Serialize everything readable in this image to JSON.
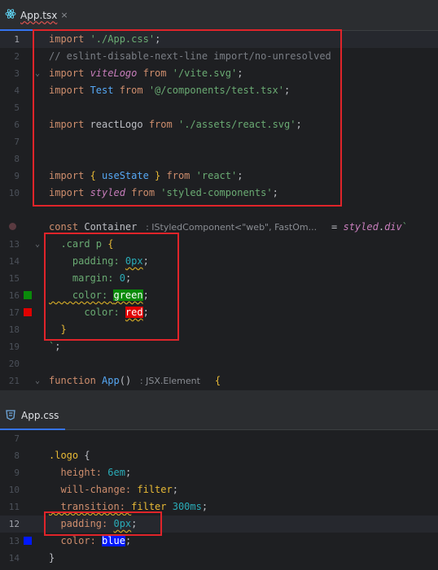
{
  "top_tab": {
    "icon": "react-icon",
    "label": "App.tsx",
    "close": "×"
  },
  "bottom_tab": {
    "icon": "css-icon",
    "label": "App.css"
  },
  "top_lines": [
    {
      "n": "1",
      "parts": [
        [
          "k",
          "import "
        ],
        [
          "s",
          "'./App.css'"
        ],
        [
          "p",
          ";"
        ]
      ]
    },
    {
      "n": "2",
      "parts": [
        [
          "c",
          "// eslint-disable-next-line import/no-unresolved"
        ]
      ]
    },
    {
      "n": "3",
      "parts": [
        [
          "k",
          "import "
        ],
        [
          "i",
          "viteLogo"
        ],
        [
          "k",
          " from "
        ],
        [
          "s",
          "'/vite.svg'"
        ],
        [
          "p",
          ";"
        ]
      ]
    },
    {
      "n": "4",
      "parts": [
        [
          "k",
          "import "
        ],
        [
          "t",
          "Test"
        ],
        [
          "k",
          " from "
        ],
        [
          "s",
          "'@/components/test.tsx'"
        ],
        [
          "p",
          ";"
        ]
      ]
    },
    {
      "n": "5",
      "parts": []
    },
    {
      "n": "6",
      "parts": [
        [
          "k",
          "import "
        ],
        [
          "p",
          "reactLogo"
        ],
        [
          "k",
          " from "
        ],
        [
          "s",
          "'./assets/react.svg'"
        ],
        [
          "p",
          ";"
        ]
      ]
    },
    {
      "n": "7",
      "parts": []
    },
    {
      "n": "8",
      "parts": []
    },
    {
      "n": "9",
      "parts": [
        [
          "k",
          "import "
        ],
        [
          "y",
          "{ "
        ],
        [
          "t",
          "useState"
        ],
        [
          "y",
          " }"
        ],
        [
          "k",
          " from "
        ],
        [
          "s",
          "'react'"
        ],
        [
          "p",
          ";"
        ]
      ]
    },
    {
      "n": "10",
      "parts": [
        [
          "k",
          "import "
        ],
        [
          "i",
          "styled"
        ],
        [
          "k",
          " from "
        ],
        [
          "s",
          "'styled-components'"
        ],
        [
          "p",
          ";"
        ]
      ]
    },
    {
      "n": "",
      "parts": []
    },
    {
      "n": "",
      "parts": [
        [
          "k",
          "const "
        ],
        [
          "p",
          "Container "
        ],
        [
          "hint",
          " : IStyledComponent<\"web\", FastOm... "
        ],
        [
          "p",
          "  = "
        ],
        [
          "i",
          "styled"
        ],
        [
          "p",
          "."
        ],
        [
          "i",
          "div"
        ],
        [
          "s",
          "`"
        ]
      ]
    },
    {
      "n": "13",
      "parts": [
        [
          "s",
          "  .card p "
        ],
        [
          "y",
          "{"
        ]
      ]
    },
    {
      "n": "14",
      "parts": [
        [
          "s",
          "    padding: "
        ],
        [
          "n",
          "0px"
        ],
        [
          "p",
          ";"
        ]
      ]
    },
    {
      "n": "15",
      "parts": [
        [
          "s",
          "    margin: "
        ],
        [
          "n",
          "0"
        ],
        [
          "p",
          ";"
        ]
      ]
    },
    {
      "n": "16",
      "parts": [
        [
          "s",
          "    color: "
        ],
        [
          "green",
          "green"
        ],
        [
          "p",
          ";"
        ]
      ]
    },
    {
      "n": "17",
      "parts": [
        [
          "s",
          "      color: "
        ],
        [
          "red",
          "red"
        ],
        [
          "p",
          ";"
        ]
      ]
    },
    {
      "n": "18",
      "parts": [
        [
          "y",
          "  }"
        ]
      ]
    },
    {
      "n": "19",
      "parts": [
        [
          "s",
          "`"
        ],
        [
          "p",
          ";"
        ]
      ]
    },
    {
      "n": "20",
      "parts": []
    },
    {
      "n": "21",
      "parts": [
        [
          "k",
          "function "
        ],
        [
          "t",
          "App"
        ],
        [
          "p",
          "() "
        ],
        [
          "hint",
          " : JSX.Element "
        ],
        [
          "y",
          "  {"
        ]
      ]
    }
  ],
  "bottom_lines": [
    {
      "n": "7",
      "parts": []
    },
    {
      "n": "8",
      "parts": [
        [
          "y",
          ".logo "
        ],
        [
          "p",
          "{"
        ]
      ]
    },
    {
      "n": "9",
      "parts": [
        [
          "k",
          "  height: "
        ],
        [
          "n",
          "6em"
        ],
        [
          "p",
          ";"
        ]
      ]
    },
    {
      "n": "10",
      "parts": [
        [
          "k",
          "  will-change: "
        ],
        [
          "y",
          "filter"
        ],
        [
          "p",
          ";"
        ]
      ]
    },
    {
      "n": "11",
      "parts": [
        [
          "k",
          "  transition: "
        ],
        [
          "y",
          "filter "
        ],
        [
          "n",
          "300ms"
        ],
        [
          "p",
          ";"
        ]
      ]
    },
    {
      "n": "12",
      "parts": [
        [
          "k",
          "  padding: "
        ],
        [
          "n",
          "0px"
        ],
        [
          "p",
          ";"
        ]
      ]
    },
    {
      "n": "13",
      "parts": [
        [
          "k",
          "  color: "
        ],
        [
          "blue",
          "blue"
        ],
        [
          "p",
          ";"
        ]
      ]
    },
    {
      "n": "14",
      "parts": [
        [
          "p",
          "}"
        ]
      ]
    }
  ],
  "colors": {
    "swatch_green": "#0a8a0a",
    "swatch_red": "#e00000",
    "swatch_blue": "#0018ff",
    "annotation": "#e0242a"
  }
}
